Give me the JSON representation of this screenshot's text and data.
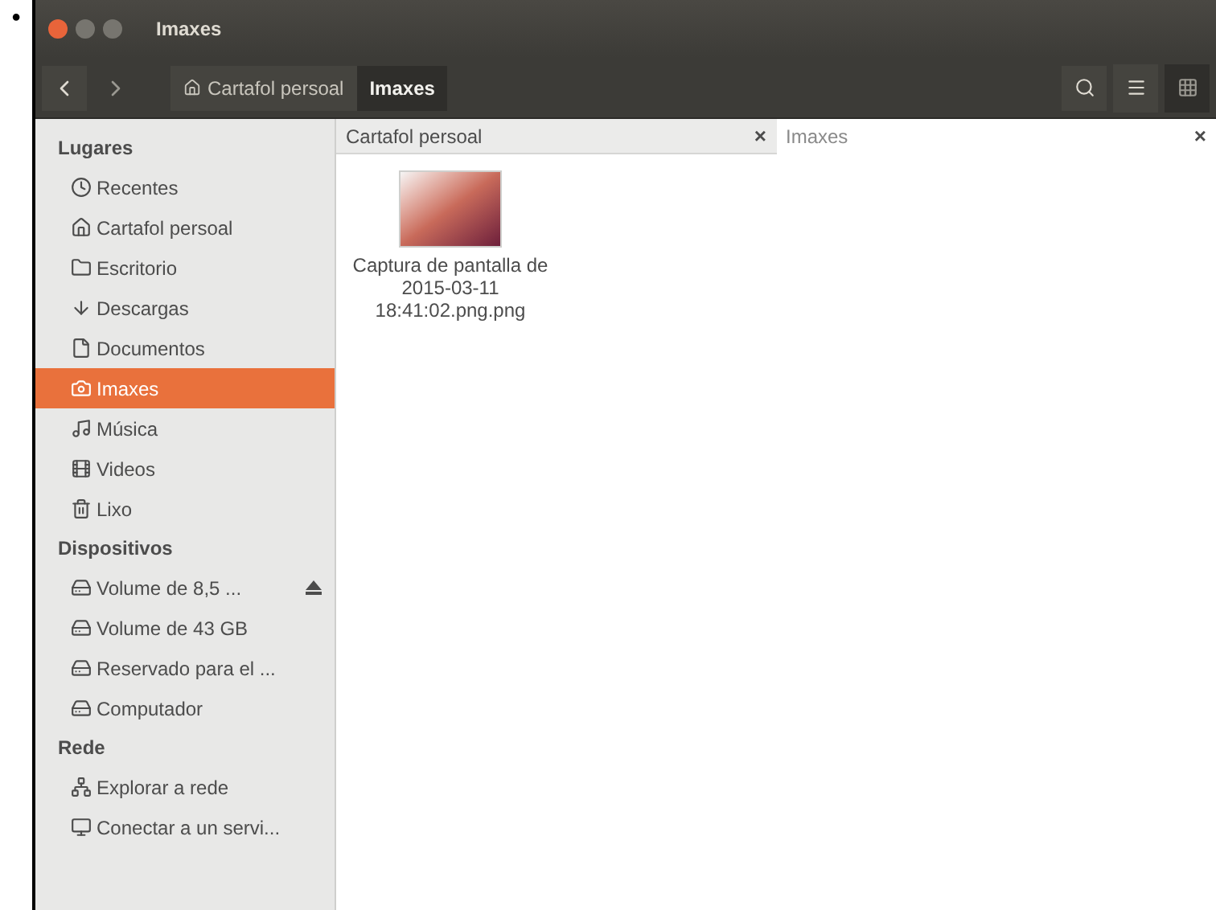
{
  "bullet": "•",
  "window": {
    "title": "Imaxes"
  },
  "toolbar": {
    "path": [
      {
        "label": "Cartafol persoal",
        "kind": "home",
        "selected": false
      },
      {
        "label": "Imaxes",
        "kind": "plain",
        "selected": true
      }
    ],
    "view_buttons": [
      {
        "kind": "list",
        "selected": false
      },
      {
        "kind": "grid",
        "selected": true
      }
    ]
  },
  "sidebar": {
    "sections": [
      {
        "heading": "Lugares",
        "items": [
          {
            "label": "Recentes",
            "kind": "clock",
            "selected": false,
            "eject": false
          },
          {
            "label": "Cartafol persoal",
            "kind": "home",
            "selected": false,
            "eject": false
          },
          {
            "label": "Escritorio",
            "kind": "desktop",
            "selected": false,
            "eject": false
          },
          {
            "label": "Descargas",
            "kind": "download",
            "selected": false,
            "eject": false
          },
          {
            "label": "Documentos",
            "kind": "document",
            "selected": false,
            "eject": false
          },
          {
            "label": "Imaxes",
            "kind": "camera",
            "selected": true,
            "eject": false
          },
          {
            "label": "Música",
            "kind": "music",
            "selected": false,
            "eject": false
          },
          {
            "label": "Videos",
            "kind": "video",
            "selected": false,
            "eject": false
          },
          {
            "label": "Lixo",
            "kind": "trash",
            "selected": false,
            "eject": false
          }
        ]
      },
      {
        "heading": "Dispositivos",
        "items": [
          {
            "label": "Volume de 8,5 ...",
            "kind": "drive",
            "selected": false,
            "eject": true
          },
          {
            "label": "Volume de 43 GB",
            "kind": "drive",
            "selected": false,
            "eject": false
          },
          {
            "label": "Reservado para el ...",
            "kind": "drive",
            "selected": false,
            "eject": false
          },
          {
            "label": "Computador",
            "kind": "drive",
            "selected": false,
            "eject": false
          }
        ]
      },
      {
        "heading": "Rede",
        "items": [
          {
            "label": "Explorar a rede",
            "kind": "network",
            "selected": false,
            "eject": false
          },
          {
            "label": "Conectar a un servi...",
            "kind": "server",
            "selected": false,
            "eject": false
          }
        ]
      }
    ]
  },
  "tabs": [
    {
      "label": "Cartafol persoal",
      "selected": false,
      "close": "×"
    },
    {
      "label": "Imaxes",
      "selected": true,
      "close": "×"
    }
  ],
  "files": [
    {
      "name": "Captura de pantalla de 2015-03-11 18:41:02.png.png"
    }
  ]
}
